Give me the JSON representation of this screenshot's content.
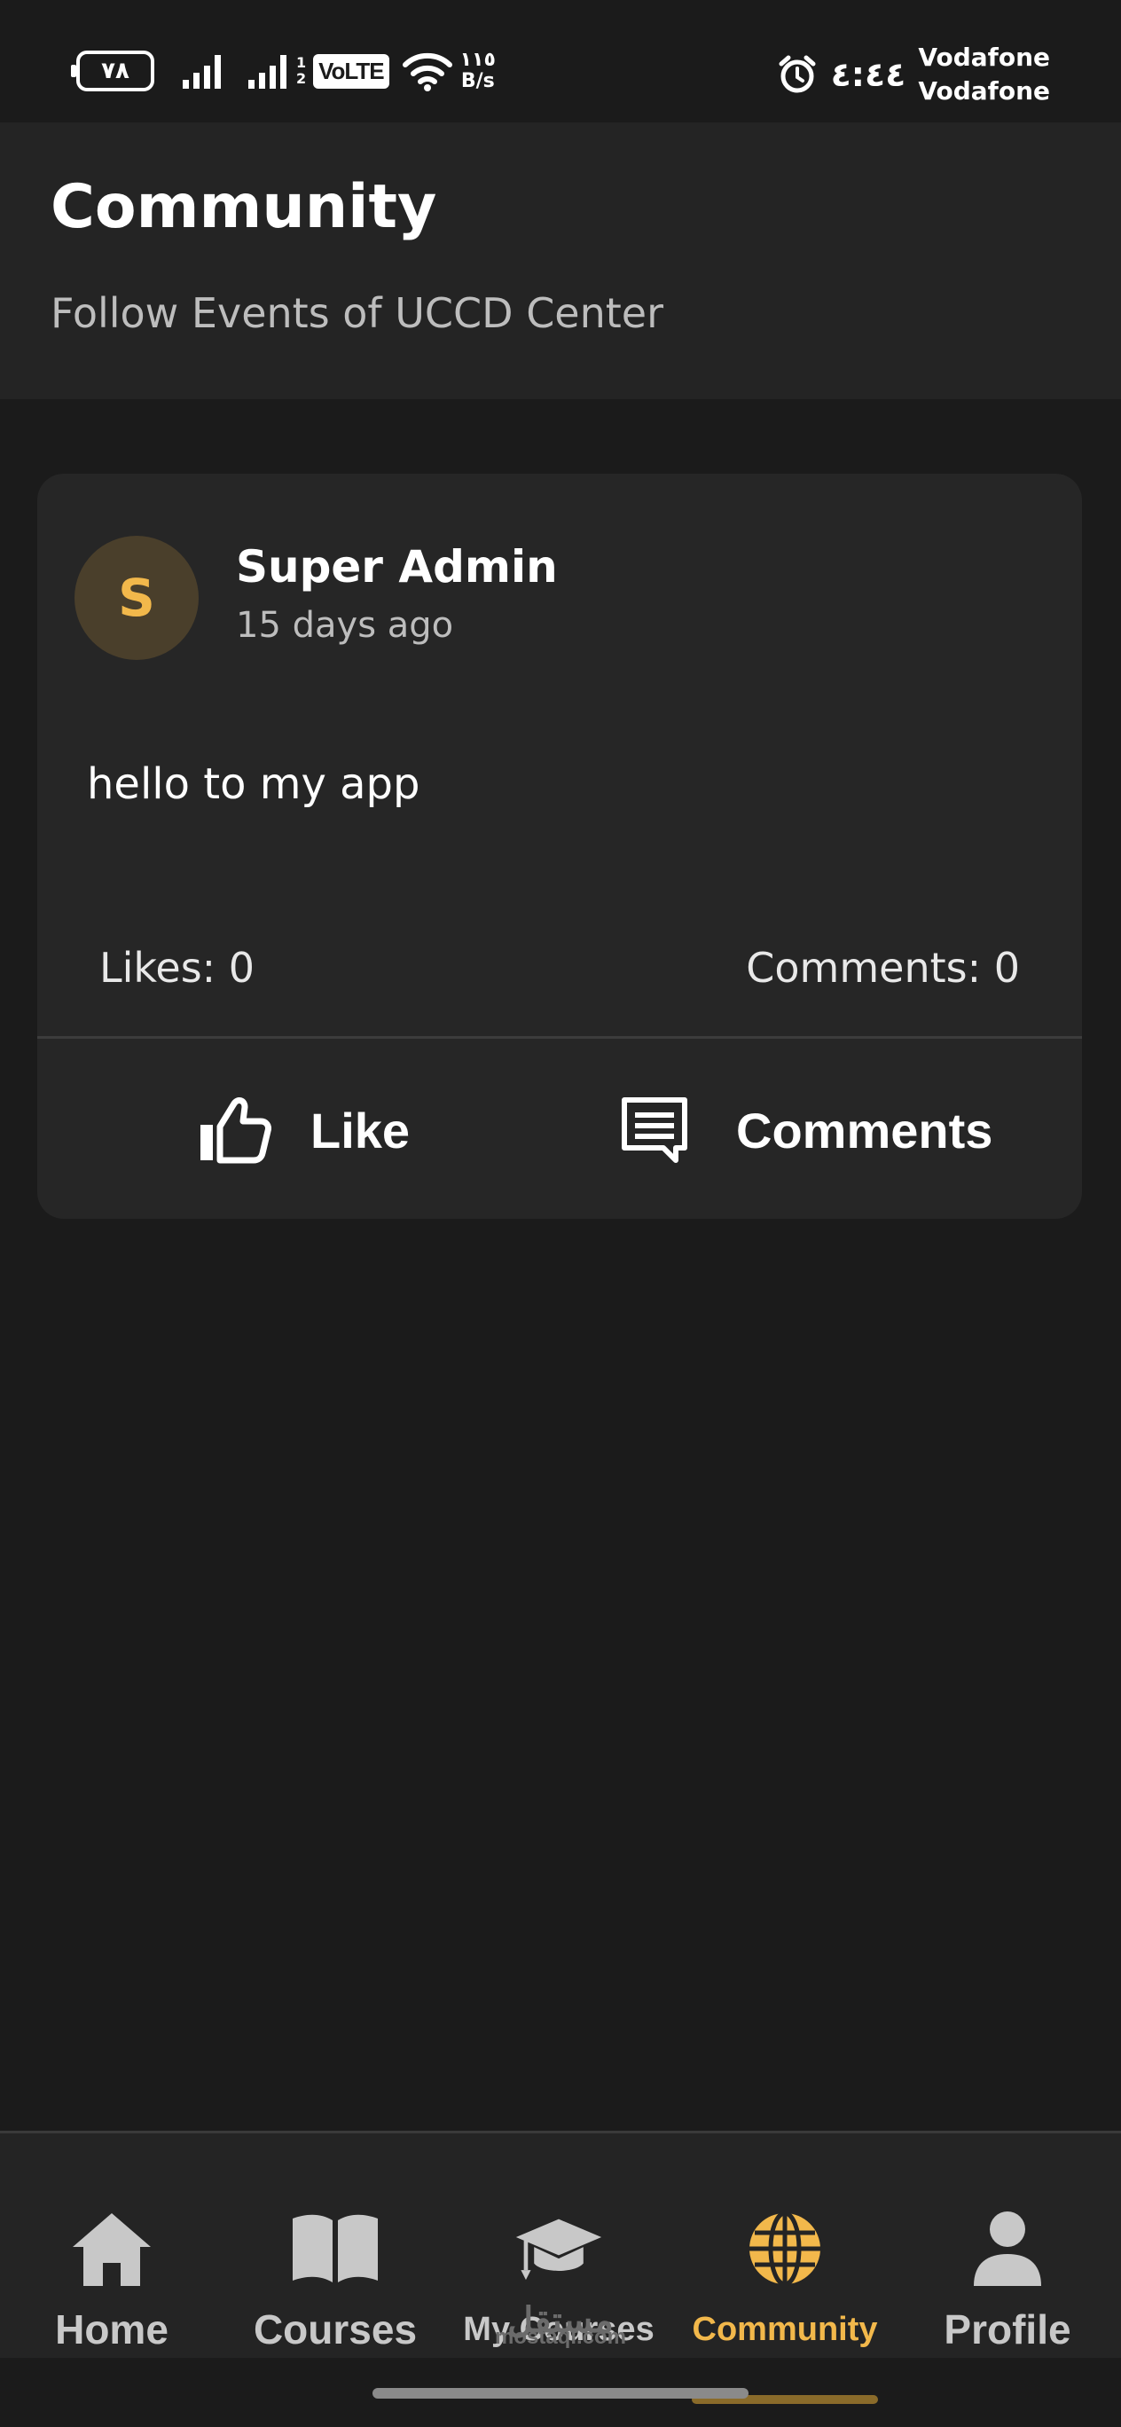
{
  "status_bar": {
    "battery_level": "٧٨",
    "volte_label": "VoLTE",
    "sim_numbers": [
      "1",
      "2"
    ],
    "net_speed_value": "١١٥",
    "net_speed_unit": "B/s",
    "time": "٤:٤٤",
    "carriers": [
      "Vodafone",
      "Vodafone"
    ]
  },
  "header": {
    "title": "Community",
    "subtitle": "Follow Events of UCCD Center"
  },
  "post": {
    "avatar_initial": "S",
    "author": "Super Admin",
    "time_ago": "15 days ago",
    "body": "hello to my app",
    "likes_text": "Likes: 0",
    "comments_text": "Comments: 0",
    "like_label": "Like",
    "comments_label": "Comments"
  },
  "bottom_nav": {
    "items": [
      {
        "label": "Home",
        "icon": "home-icon"
      },
      {
        "label": "Courses",
        "icon": "book-icon"
      },
      {
        "label": "My Courses",
        "icon": "graduation-cap-icon"
      },
      {
        "label": "Community",
        "icon": "globe-icon",
        "active": true
      },
      {
        "label": "Profile",
        "icon": "user-icon"
      }
    ]
  },
  "watermark": {
    "arabic": "مستقل",
    "site": "mostaql.com"
  },
  "colors": {
    "background": "#1b1b1b",
    "surface": "#242424",
    "card": "#262626",
    "accent": "#f2b84b",
    "muted_text": "#bdbdbd"
  }
}
